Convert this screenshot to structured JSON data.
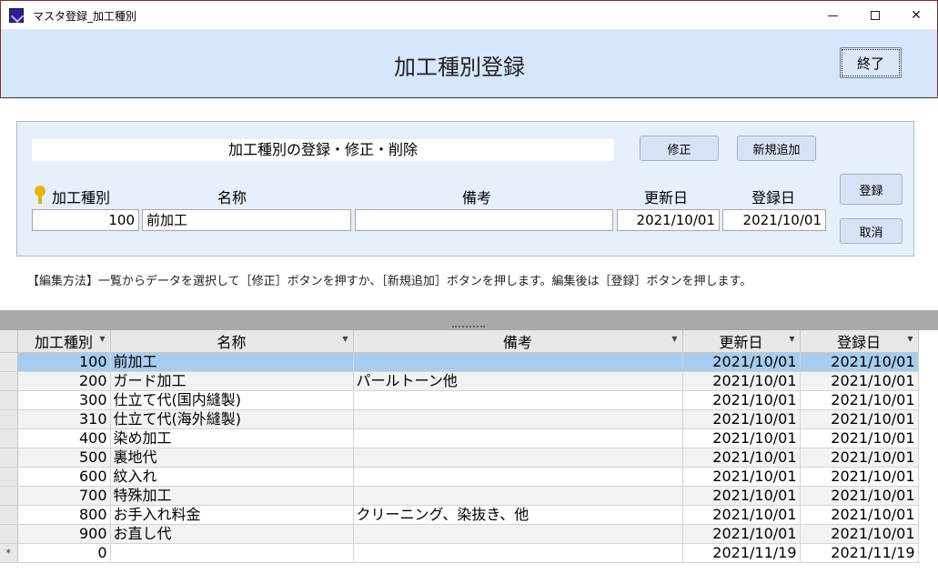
{
  "window": {
    "title": "マスタ登録_加工種別",
    "min_glyph": "",
    "max_glyph": "",
    "close_glyph": "✕"
  },
  "header": {
    "title": "加工種別登録",
    "exit_label": "終了"
  },
  "form": {
    "caption": "加工種別の登録・修正・削除",
    "edit_label": "修正",
    "new_label": "新規追加",
    "register_label": "登録",
    "cancel_label": "取消",
    "labels": {
      "code": "加工種別",
      "name": "名称",
      "note": "備考",
      "updated": "更新日",
      "registered": "登録日"
    },
    "values": {
      "code": "100",
      "name": "前加工",
      "note": "",
      "updated": "2021/10/01",
      "registered": "2021/10/01"
    }
  },
  "help_text": "【編集方法】一覧からデータを選択して［修正］ボタンを押すか、［新規追加］ボタンを押します。編集後は［登録］ボタンを押します。",
  "grid": {
    "columns": [
      "加工種別",
      "名称",
      "備考",
      "更新日",
      "登録日"
    ],
    "rows": [
      {
        "code": "100",
        "name": "前加工",
        "note": "",
        "updated": "2021/10/01",
        "registered": "2021/10/01"
      },
      {
        "code": "200",
        "name": "ガード加工",
        "note": "パールトーン他",
        "updated": "2021/10/01",
        "registered": "2021/10/01"
      },
      {
        "code": "300",
        "name": "仕立て代(国内縫製)",
        "note": "",
        "updated": "2021/10/01",
        "registered": "2021/10/01"
      },
      {
        "code": "310",
        "name": "仕立て代(海外縫製)",
        "note": "",
        "updated": "2021/10/01",
        "registered": "2021/10/01"
      },
      {
        "code": "400",
        "name": "染め加工",
        "note": "",
        "updated": "2021/10/01",
        "registered": "2021/10/01"
      },
      {
        "code": "500",
        "name": "裏地代",
        "note": "",
        "updated": "2021/10/01",
        "registered": "2021/10/01"
      },
      {
        "code": "600",
        "name": "紋入れ",
        "note": "",
        "updated": "2021/10/01",
        "registered": "2021/10/01"
      },
      {
        "code": "700",
        "name": "特殊加工",
        "note": "",
        "updated": "2021/10/01",
        "registered": "2021/10/01"
      },
      {
        "code": "800",
        "name": "お手入れ料金",
        "note": "クリーニング、染抜き、他",
        "updated": "2021/10/01",
        "registered": "2021/10/01"
      },
      {
        "code": "900",
        "name": "お直し代",
        "note": "",
        "updated": "2021/10/01",
        "registered": "2021/10/01"
      }
    ],
    "new_row": {
      "marker": "*",
      "code": "0",
      "name": "",
      "note": "",
      "updated": "2021/11/19",
      "registered": "2021/11/19"
    }
  }
}
